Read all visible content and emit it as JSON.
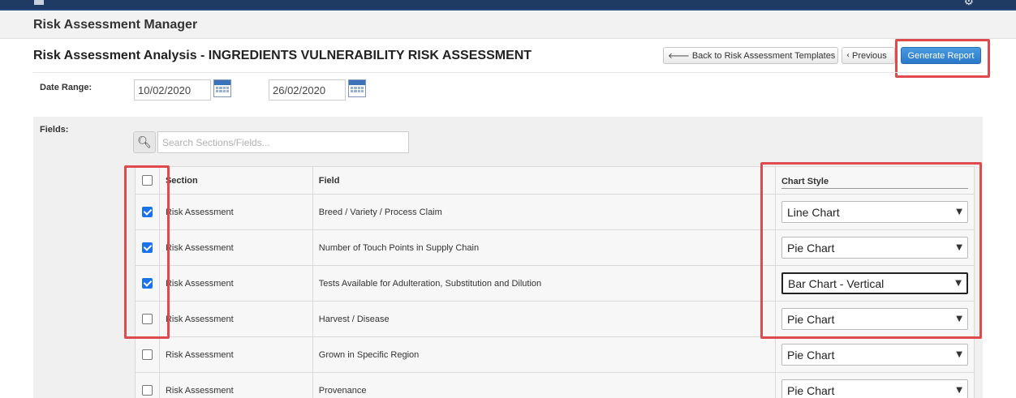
{
  "topbar": {
    "settings_icon": "gear-icon"
  },
  "app": {
    "title": "Risk Assessment Manager"
  },
  "page": {
    "title": "Risk Assessment Analysis - INGREDIENTS VULNERABILITY RISK ASSESSMENT"
  },
  "toolbar": {
    "back_label": "Back to Risk Assessment Templates",
    "previous_label": "Previous",
    "generate_label": "Generate Report"
  },
  "date_range": {
    "label": "Date Range:",
    "from": "10/02/2020",
    "to": "26/02/2020"
  },
  "fields": {
    "label": "Fields:",
    "search_placeholder": "Search Sections/Fields...",
    "columns": {
      "section": "Section",
      "field": "Field",
      "chart_style": "Chart Style"
    },
    "rows": [
      {
        "checked": true,
        "section": "Risk Assessment",
        "field": "Breed / Variety / Process Claim",
        "chart": "Line Chart"
      },
      {
        "checked": true,
        "section": "Risk Assessment",
        "field": "Number of Touch Points in Supply Chain",
        "chart": "Pie Chart"
      },
      {
        "checked": true,
        "section": "Risk Assessment",
        "field": "Tests Available for Adulteration, Substitution and Dilution",
        "chart": "Bar Chart - Vertical"
      },
      {
        "checked": false,
        "section": "Risk Assessment",
        "field": "Harvest / Disease",
        "chart": "Pie Chart"
      },
      {
        "checked": false,
        "section": "Risk Assessment",
        "field": "Grown in Specific Region",
        "chart": "Pie Chart"
      },
      {
        "checked": false,
        "section": "Risk Assessment",
        "field": "Provenance",
        "chart": "Pie Chart"
      }
    ]
  },
  "colors": {
    "highlight": "#e04a4f",
    "primary": "#2a78c8",
    "header": "#1f3b63"
  }
}
